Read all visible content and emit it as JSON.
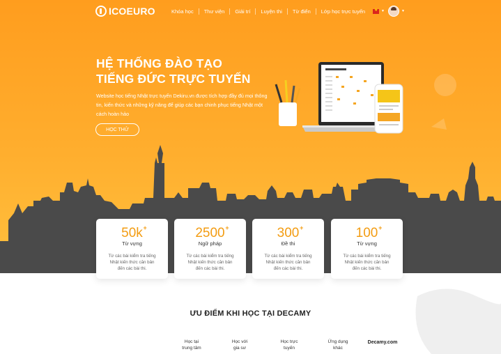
{
  "header": {
    "logo_text": "ICOEURO",
    "nav": [
      "Khóa học",
      "Thư viện",
      "Giải trí",
      "Luyện thi",
      "Từ điển",
      "Lớp học trực tuyến"
    ]
  },
  "hero": {
    "title_line1": "HỆ THỐNG ĐÀO TẠO",
    "title_line2": "TIẾNG ĐỨC TRỰC TUYẾN",
    "description": "Website học tiếng Nhật trực tuyến Dekiru.vn được tích hợp đầy đủ mọi thông tin, kiến thức và những kỹ năng để giúp các bạn chinh phục tiếng Nhật một cách hoàn hảo",
    "cta_label": "HỌC THỬ"
  },
  "stats": [
    {
      "value": "50k",
      "plus": "+",
      "label": "Từ vựng",
      "desc": "Từ các bài kiểm tra tiếng Nhật kiến thức căn bản đến các bài thi."
    },
    {
      "value": "2500",
      "plus": "+",
      "label": "Ngữ pháp",
      "desc": "Từ các bài kiểm tra tiếng Nhật kiến thức căn bản đến các bài thi."
    },
    {
      "value": "300",
      "plus": "+",
      "label": "Đề thi",
      "desc": "Từ các bài kiểm tra tiếng Nhật kiến thức căn bản đến các bài thi."
    },
    {
      "value": "100",
      "plus": "+",
      "label": "Từ vựng",
      "desc": "Từ các bài kiểm tra tiếng Nhật kiến thức căn bản đến các bài thi."
    }
  ],
  "advantages": {
    "title": "ƯU ĐIỂM KHI HỌC TẠI DECAMY",
    "tabs": [
      {
        "line1": "Học tại",
        "line2": "trung tâm"
      },
      {
        "line1": "Học với",
        "line2": "gia sư"
      },
      {
        "line1": "Học trực",
        "line2": "tuyến"
      },
      {
        "line1": "Ứng dụng",
        "line2": "khác"
      },
      {
        "line1": "Decamy.com",
        "line2": ""
      }
    ]
  },
  "colors": {
    "primary": "#ff9d1e",
    "accent_number": "#f39c12",
    "skyline": "#4a4a4a"
  }
}
